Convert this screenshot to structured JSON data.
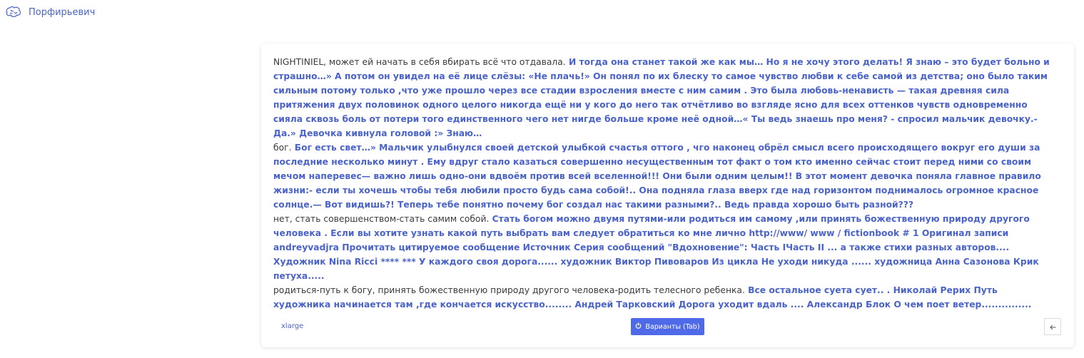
{
  "app": {
    "brand_name": "Порфирьевич",
    "logo_icon": "brain-icon",
    "accent_color": "#4a63c8",
    "button_color": "#4f6ae8"
  },
  "editor": {
    "paragraphs": [
      {
        "original": "NIGHTINIEL, может ей начать в себя вбирать всё что отдавала.",
        "generated": " И тогда она станет такой же как мы… Но я не хочу этого делать! Я знаю – это будет больно и страшно…» А потом он увидел на её лице слёзы: «Не плачь!» Он понял по их блеску то самое чувство любви к себе самой из детства; оно было таким сильным потому только ,что уже прошло через все стадии взросления вместе с ним самим . Это была любовь-ненависть — такая древняя сила притяжения двух половинок одного целого никогда ещё ни у кого до него так отчётливо во взгляде ясно для всех оттенков чувств одновременно сияла сквозь боль от потери того единственного чего нет нигде больше кроме неё одной…« Ты ведь знаешь про меня? - спросил мальчик девочку.- Да.» Девочка кивнула головой :» Знаю…"
      },
      {
        "original": "бог.",
        "generated": " Бог есть свет…» Мальчик улыбнулся своей детской улыбкой счастья оттого , чго наконец обрёл смысл всего происходящего вокруг его души за последние несколько минут . Ему вдруг стало казаться совершенно несущественным тот факт о том кто именно сейчас стоит перед ними со своим мечом наперевес— важно лишь одно-они вдвоём против всей вселенной!!! Они были одним целым!! В этот момент девочка поняла главное правило жизни:- если ты хочешь чтобы тебя любили просто будь сама собой!.. Она подняла глаза вверх где над горизонтом поднималось огромное красное солнце.— Вот видишь?! Теперь тебе понятно почему бог создал нас такими разными?.. Ведь правда хорошо быть разной???"
      },
      {
        "original": "нет, стать совершенством-стать самим собой.",
        "generated": " Стать богом можно двумя путями-или родиться им самому ,или принять божественную природу другого человека . Если вы хотите узнать какой путь выбрать вам следует обратиться ко мне лично http://www/ www / fictionbook # 1 Оригинал записи andreyvadjra Прочитать цитируемое сообщение Источник Серия сообщений \"Вдохновение\": Часть IЧасть II ... а также стихи разных авторов.... Художник Nina Ricci **** *** У каждого своя дорога...... художник Виктор Пивоваров Из цикла Не уходи никуда ...... художница Анна Сазонова Крик петуха....."
      },
      {
        "original": "родиться-путь к богу, принять божественную природу другого человека-родить телесного ребенка.",
        "generated": " Все остальное суета сует.. . Николай Рерих Путь художника начинается там ,где кончается искусство........ Андрей Тарковский Дорога уходит вдаль .... Александр Блок О чем поет ветер............... Владимир Высоцкий Поет зима................................ Михаил Лермонтов Как прекрасен закатный багрянец заката !!!!!!!!!!!!!!!!! Сергей Есенин Песнь дороги ... Борис Пастернак На дороге осень листопадом шуршит под ногами .."
      }
    ]
  },
  "footer": {
    "model_label": "xlarge",
    "variants_button_label": "Варианты (Tab)",
    "variants_icon": "power-icon",
    "back_icon": "arrow-left-icon"
  }
}
